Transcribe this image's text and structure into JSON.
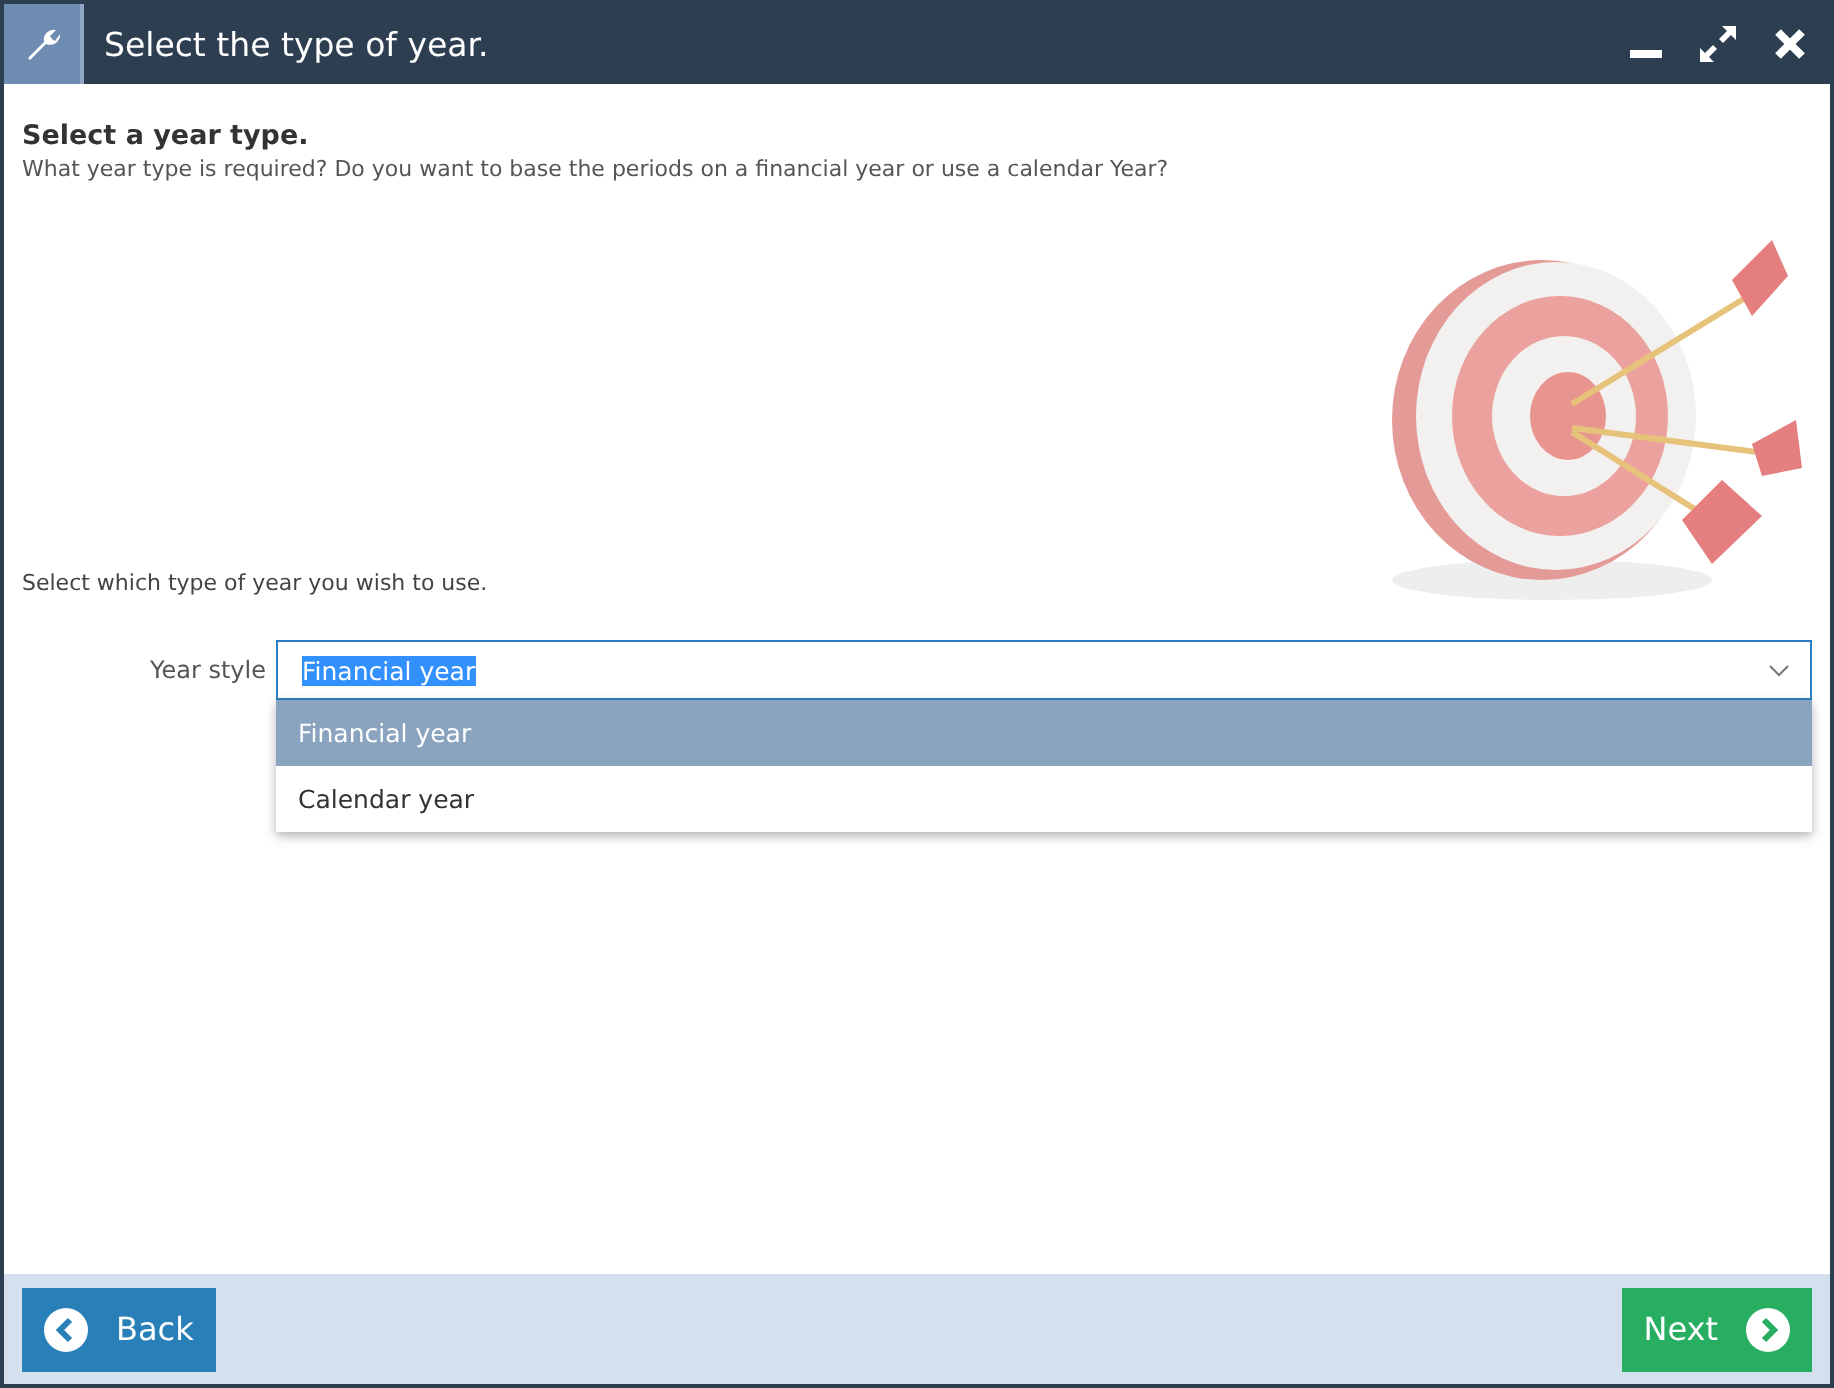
{
  "window": {
    "title": "Select the type of year."
  },
  "heading": "Select a year type.",
  "description": "What year type is required? Do you want to base the periods on a financial year or use a calendar Year?",
  "prompt": "Select which type of year you wish to use.",
  "year_style": {
    "label": "Year style",
    "value": "Financial year",
    "expanded": true,
    "options": [
      {
        "label": "Financial year",
        "selected": true
      },
      {
        "label": "Calendar year",
        "selected": false
      }
    ]
  },
  "buttons": {
    "back": "Back",
    "next": "Next"
  }
}
